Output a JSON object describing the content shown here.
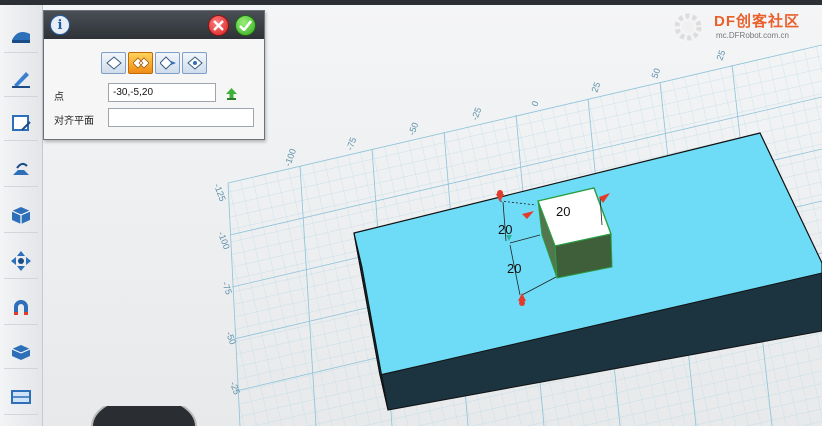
{
  "panel": {
    "info_icon": "info-icon",
    "cancel_icon": "cancel-icon",
    "ok_icon": "check-icon",
    "modes": [
      {
        "name": "align-mode-1",
        "active": false
      },
      {
        "name": "align-mode-2",
        "active": true
      },
      {
        "name": "align-mode-3",
        "active": false
      },
      {
        "name": "align-mode-4",
        "active": false
      }
    ],
    "point_label": "点",
    "point_value": "-30,-5,20",
    "plane_label": "对齐平面",
    "plane_value": ""
  },
  "logo": {
    "text": "DF创客社区",
    "subtitle": "mc.DFRobot.com.cn"
  },
  "toolbar": [
    "basic-shapes-icon",
    "sketch-icon",
    "sketch-edit-icon",
    "feature-ops-icon",
    "special-functions-icon",
    "move-icon",
    "magnet-icon",
    "material-icon",
    "grid-icon"
  ],
  "grid_labels": [
    "25",
    "0",
    "25",
    "50",
    "75",
    "-25",
    "-50",
    "-75",
    "-100",
    "-125",
    "-100",
    "-75",
    "-50",
    "-25"
  ],
  "dimensions": [
    "20",
    "20",
    "20"
  ],
  "colors": {
    "block_top": "#6fdcf7",
    "block_side": "#1c3340",
    "cube_top": "#ffffff",
    "cube_side": "#3f5e3a",
    "grid_line": "#8cc3d9",
    "accent": "#e8602c"
  }
}
